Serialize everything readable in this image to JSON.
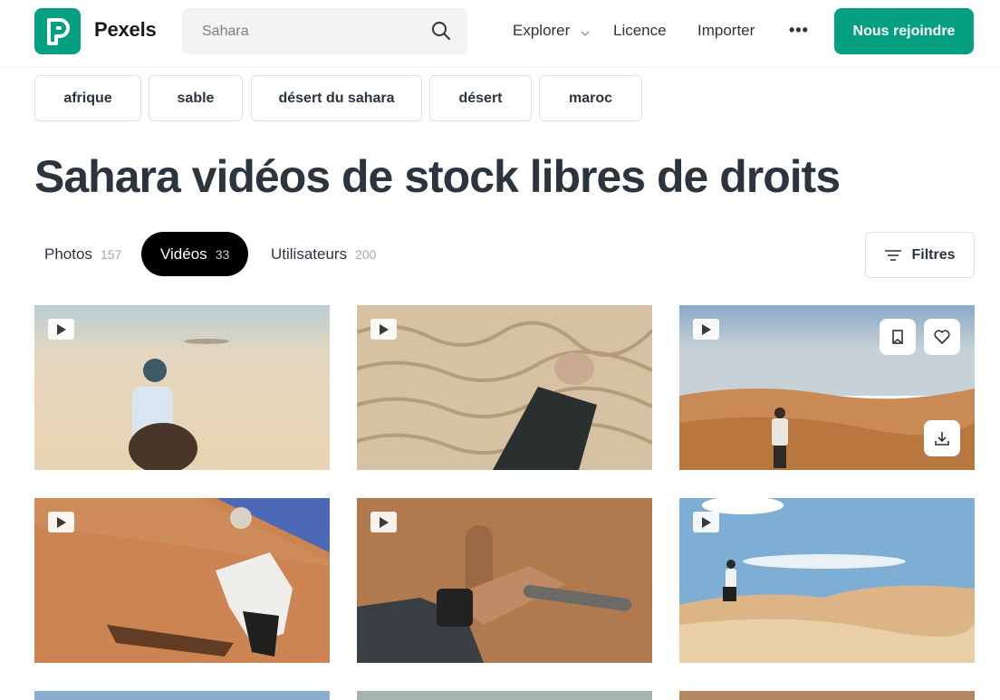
{
  "header": {
    "brand": "Pexels",
    "search_placeholder": "Sahara",
    "nav": {
      "explorer": "Explorer",
      "licence": "Licence",
      "importer": "Importer",
      "more": "•••"
    },
    "join_label": "Nous rejoindre"
  },
  "tags": [
    "afrique",
    "sable",
    "désert du sahara",
    "désert",
    "maroc"
  ],
  "title": "Sahara vidéos de stock libres de droits",
  "tabs": [
    {
      "label": "Photos",
      "count": "157"
    },
    {
      "label": "Vidéos",
      "count": "33"
    },
    {
      "label": "Utilisateurs",
      "count": "200"
    }
  ],
  "filters_label": "Filtres",
  "colors": {
    "brand": "#05a081",
    "text": "#2c343e",
    "active_tab": "#000000"
  },
  "videos": [
    {
      "icon": "play-icon",
      "scene": "camel-rider"
    },
    {
      "icon": "play-icon",
      "scene": "sand-hand"
    },
    {
      "icon": "play-icon",
      "scene": "dunes-walker",
      "actions": [
        "collection-icon",
        "heart-icon",
        "download-icon"
      ]
    },
    {
      "icon": "play-icon",
      "scene": "orange-dune-climber"
    },
    {
      "icon": "play-icon",
      "scene": "hand-closeup"
    },
    {
      "icon": "play-icon",
      "scene": "running-dunes"
    }
  ]
}
